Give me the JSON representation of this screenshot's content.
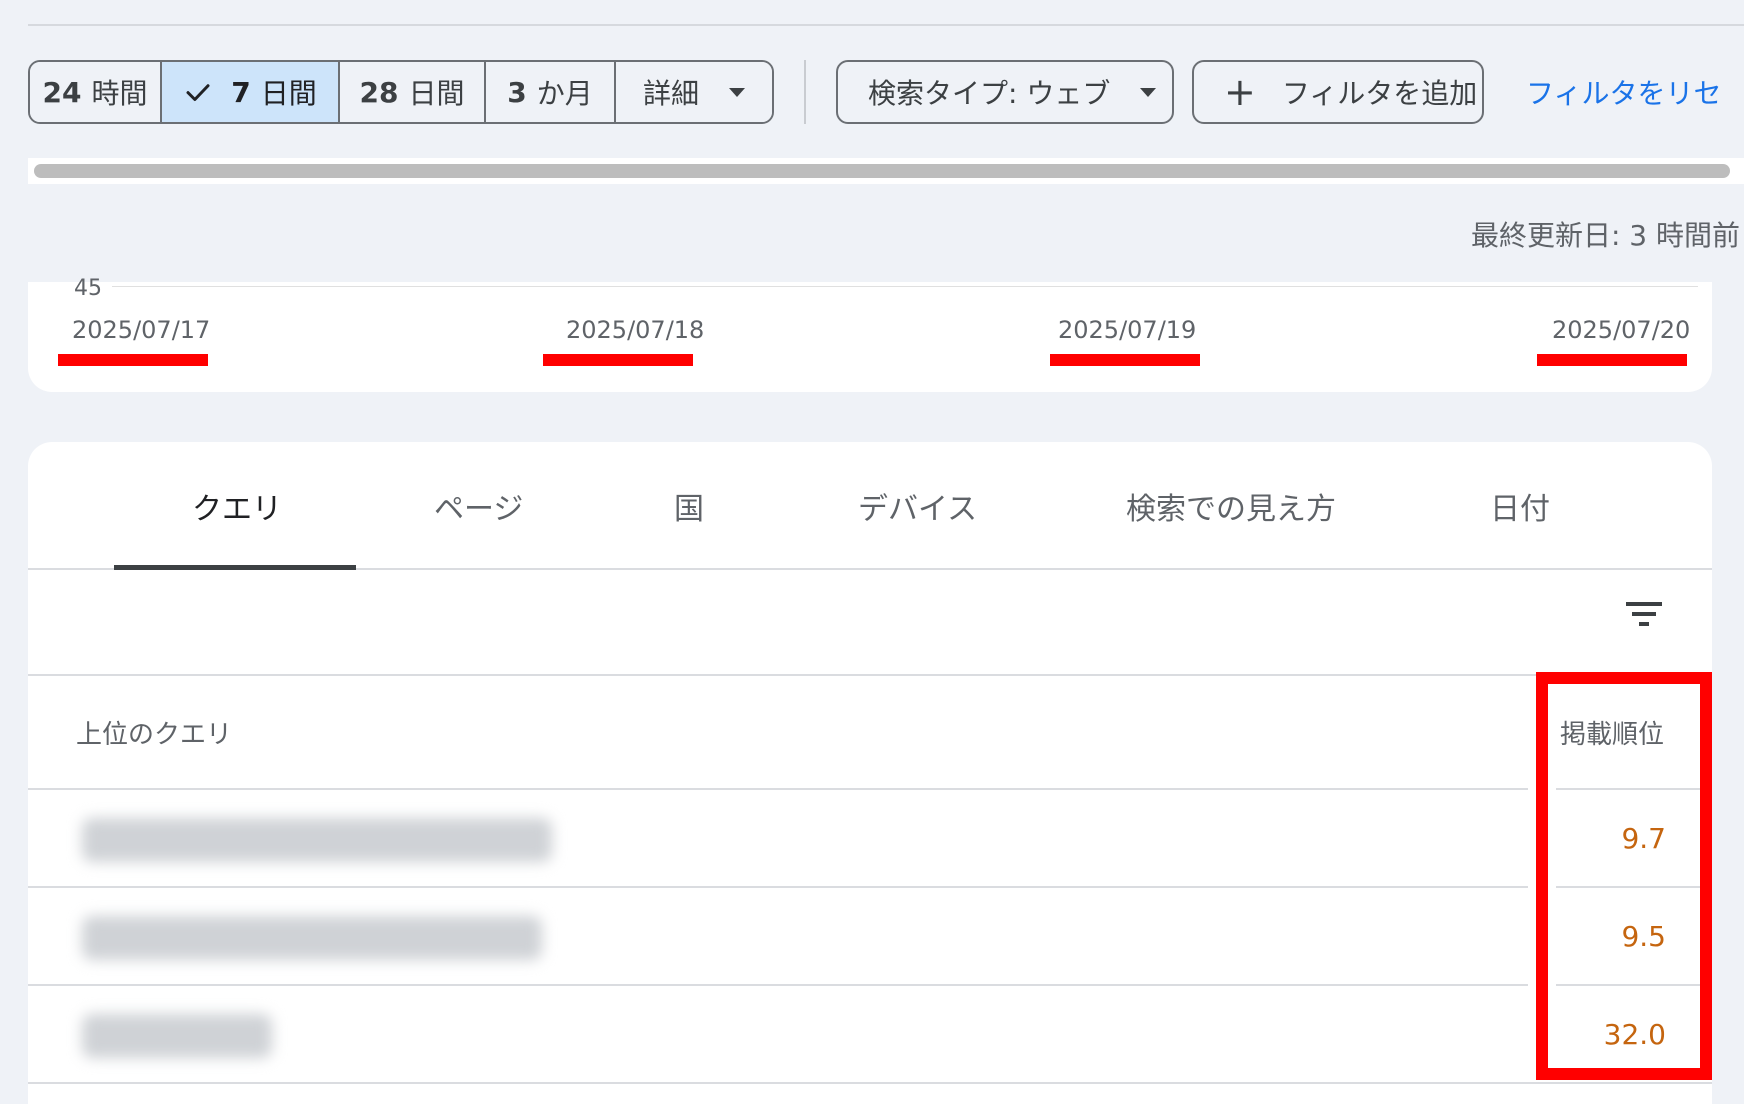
{
  "toolbar": {
    "ranges": [
      {
        "num": "24",
        "unit": "時間"
      },
      {
        "num": "7",
        "unit": "日間"
      },
      {
        "num": "28",
        "unit": "日間"
      },
      {
        "num": "3",
        "unit": "か月"
      }
    ],
    "selected_range": "7 日間",
    "detail_label": "詳細",
    "search_type_label": "検索タイプ: ウェブ",
    "add_filter_label": "フィルタを追加",
    "reset_filter_label": "フィルタをリセ"
  },
  "status": {
    "last_updated": "最終更新日: 3 時間前"
  },
  "chart": {
    "y_tick": "45",
    "x_ticks": [
      "2025/07/17",
      "2025/07/18",
      "2025/07/19",
      "2025/07/20"
    ],
    "highlight_color": "#ff0000"
  },
  "table": {
    "tabs": [
      "クエリ",
      "ページ",
      "国",
      "デバイス",
      "検索での見え方",
      "日付"
    ],
    "active_tab": "クエリ",
    "column_query_header": "上位のクエリ",
    "column_position_header": "掲載順位",
    "rows": [
      {
        "position": "9.7"
      },
      {
        "position": "9.5"
      },
      {
        "position": "32.0"
      }
    ],
    "position_color": "#c5650f"
  },
  "icons": {
    "check": "check-icon",
    "dropdown": "caret-down-icon",
    "add": "plus-icon",
    "filter": "filter-list-icon"
  },
  "colors": {
    "selected_chip_bg": "#cde4fa",
    "link": "#1a73e8",
    "annotation": "#ff0000"
  }
}
